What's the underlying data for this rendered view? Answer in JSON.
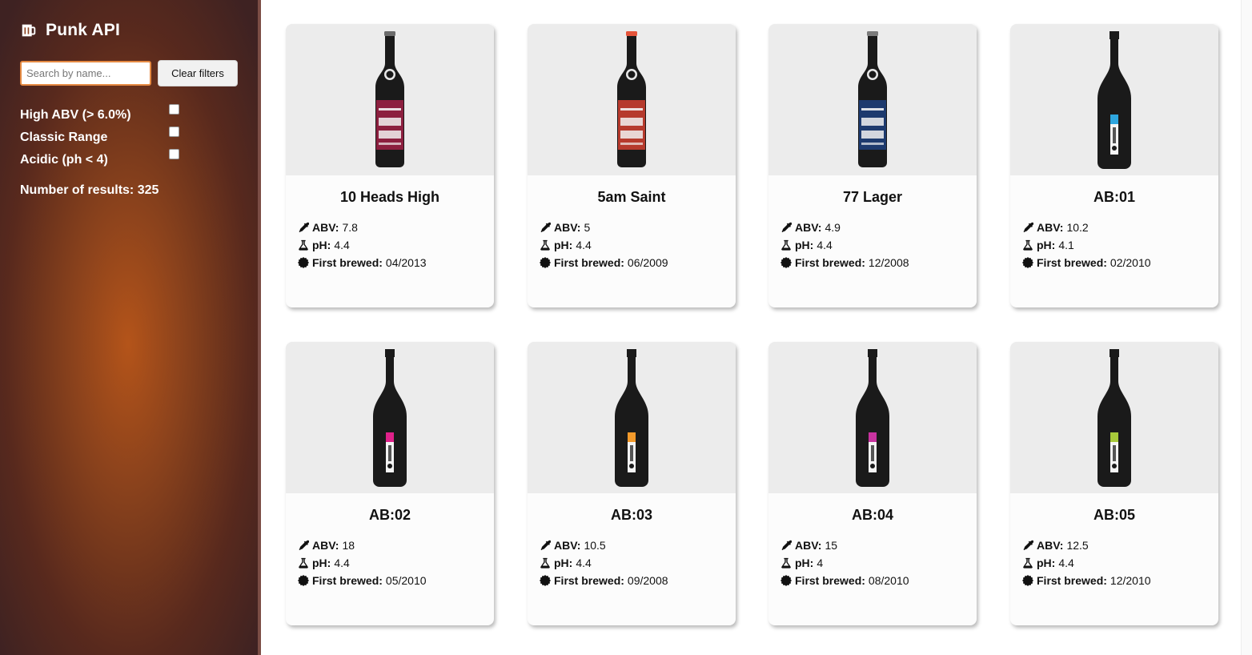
{
  "app": {
    "title": "Punk API",
    "logo_icon": "beer-mug-icon"
  },
  "sidebar": {
    "search": {
      "placeholder": "Search by name...",
      "value": ""
    },
    "clear_label": "Clear filters",
    "filters": [
      {
        "label": "High ABV (> 6.0%)",
        "checked": false
      },
      {
        "label": "Classic Range",
        "checked": false
      },
      {
        "label": "Acidic (ph < 4)",
        "checked": false
      }
    ],
    "results_text": "Number of results: 325"
  },
  "labels": {
    "abv": "ABV:",
    "ph": "pH:",
    "brewed": "First brewed:"
  },
  "beers": [
    {
      "name": "10 Heads High",
      "abv": "7.8",
      "ph": "4.4",
      "first_brewed": "04/2013",
      "bottle": "long-neck",
      "label_color": "#8c1f3f",
      "cap_color": "#6b6b6b"
    },
    {
      "name": "5am Saint",
      "abv": "5",
      "ph": "4.4",
      "first_brewed": "06/2009",
      "bottle": "long-neck",
      "label_color": "#b63a2d",
      "cap_color": "#e5543a"
    },
    {
      "name": "77 Lager",
      "abv": "4.9",
      "ph": "4.4",
      "first_brewed": "12/2008",
      "bottle": "long-neck",
      "label_color": "#1d3a6e",
      "cap_color": "#7b7b7b"
    },
    {
      "name": "AB:01",
      "abv": "10.2",
      "ph": "4.1",
      "first_brewed": "02/2010",
      "bottle": "champagne",
      "label_color": "#2ea6df",
      "cap_color": "#1b1b1b"
    },
    {
      "name": "AB:02",
      "abv": "18",
      "ph": "4.4",
      "first_brewed": "05/2010",
      "bottle": "champagne",
      "label_color": "#e0218a",
      "cap_color": "#1b1b1b"
    },
    {
      "name": "AB:03",
      "abv": "10.5",
      "ph": "4.4",
      "first_brewed": "09/2008",
      "bottle": "champagne",
      "label_color": "#f39a2b",
      "cap_color": "#1b1b1b"
    },
    {
      "name": "AB:04",
      "abv": "15",
      "ph": "4",
      "first_brewed": "08/2010",
      "bottle": "champagne",
      "label_color": "#c8339f",
      "cap_color": "#1b1b1b"
    },
    {
      "name": "AB:05",
      "abv": "12.5",
      "ph": "4.4",
      "first_brewed": "12/2010",
      "bottle": "champagne",
      "label_color": "#a7c93a",
      "cap_color": "#1b1b1b"
    }
  ],
  "icons": {
    "abv": "eyedropper-icon",
    "ph": "flask-icon",
    "brewed": "certificate-icon"
  }
}
